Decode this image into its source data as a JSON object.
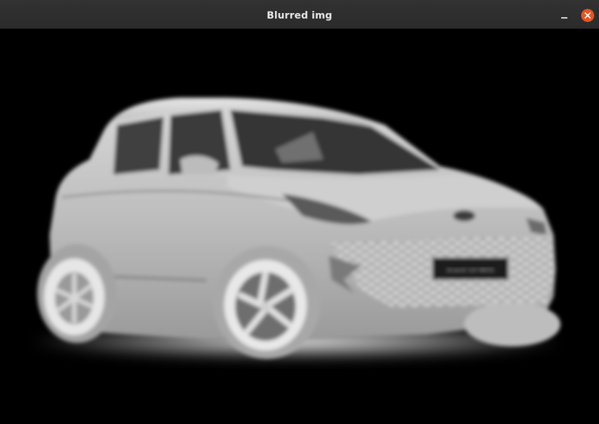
{
  "window": {
    "title": "Blurred img"
  },
  "controls": {
    "minimize_icon": "minimize-icon",
    "close_icon": "close-icon",
    "close_color": "#e95420"
  },
  "image": {
    "plate_text": "Grand i10 NIOS",
    "colors": {
      "background": "#000000",
      "body": "#c8c8c8",
      "glass": "#3a3a3a"
    }
  }
}
